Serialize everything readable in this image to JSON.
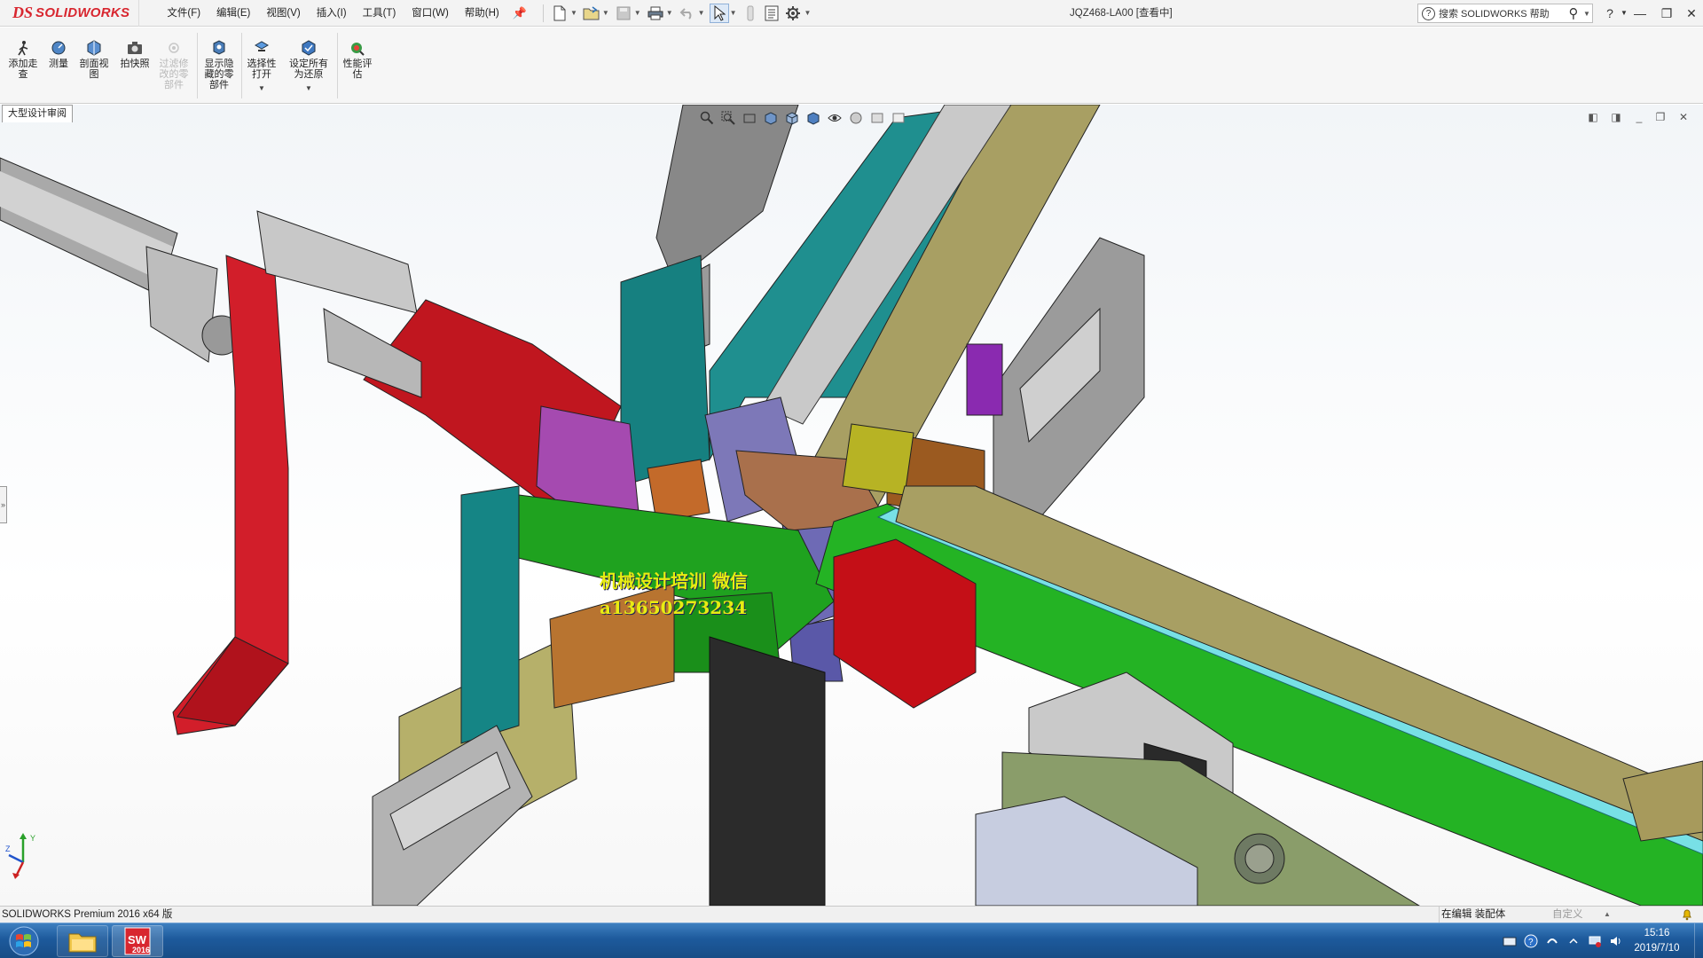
{
  "app": {
    "logo_ds": "DS",
    "logo_name": "SOLIDWORKS",
    "document_title": "JQZ468-LA00 [查看中]"
  },
  "menu": {
    "items": [
      "文件(F)",
      "编辑(E)",
      "视图(V)",
      "插入(I)",
      "工具(T)",
      "窗口(W)",
      "帮助(H)"
    ]
  },
  "quick_access": {
    "icons": [
      "new-document-icon",
      "open-folder-icon",
      "save-icon",
      "print-icon",
      "undo-icon",
      "select-arrow-icon",
      "rebuild-icon",
      "file-properties-icon",
      "options-gear-icon"
    ]
  },
  "help_search": {
    "placeholder": "搜索 SOLIDWORKS 帮助"
  },
  "window_controls": {
    "help": "?",
    "minimize": "—",
    "restore": "❐",
    "close": "✕"
  },
  "ribbon": {
    "buttons": [
      {
        "id": "add-walkthrough",
        "label": "添加走\n查",
        "icon": "walk-icon",
        "enabled": true
      },
      {
        "id": "measure",
        "label": "测量",
        "icon": "measure-icon",
        "enabled": true
      },
      {
        "id": "section-view",
        "label": "剖面视\n图",
        "icon": "section-view-icon",
        "enabled": true
      },
      {
        "id": "snapshot",
        "label": "拍快照",
        "icon": "camera-icon",
        "enabled": true
      },
      {
        "id": "filter-modified",
        "label": "过滤修\n改的零\n部件",
        "icon": "filter-icon",
        "enabled": false
      },
      {
        "id": "show-hidden",
        "label": "显示隐\n藏的零\n部件",
        "icon": "show-hidden-icon",
        "enabled": true
      },
      {
        "id": "selective-open",
        "label": "选择性\n打开",
        "icon": "selective-open-icon",
        "enabled": true
      },
      {
        "id": "set-all-resolved",
        "label": "设定所有\n为还原",
        "icon": "resolve-icon",
        "enabled": true
      },
      {
        "id": "performance-eval",
        "label": "性能评\n估",
        "icon": "performance-icon",
        "enabled": true
      }
    ]
  },
  "tabs": {
    "active": "大型设计审阅"
  },
  "viewport": {
    "watermark_line1": "机械设计培训  微信",
    "watermark_line2": "a13650273234",
    "left_handle": "»"
  },
  "status": {
    "product": "SOLIDWORKS Premium 2016 x64 版",
    "mode": "在编辑 装配体",
    "custom": "自定义"
  },
  "taskbar": {
    "apps": [
      {
        "name": "file-explorer",
        "label": ""
      },
      {
        "name": "solidworks-2016",
        "label": "2016"
      }
    ],
    "time": "15:16",
    "date": "2019/7/10"
  },
  "colors": {
    "brand_red": "#d8262f",
    "taskbar_blue": "#1d5a9c",
    "watermark_yellow": "#e8ec12"
  }
}
